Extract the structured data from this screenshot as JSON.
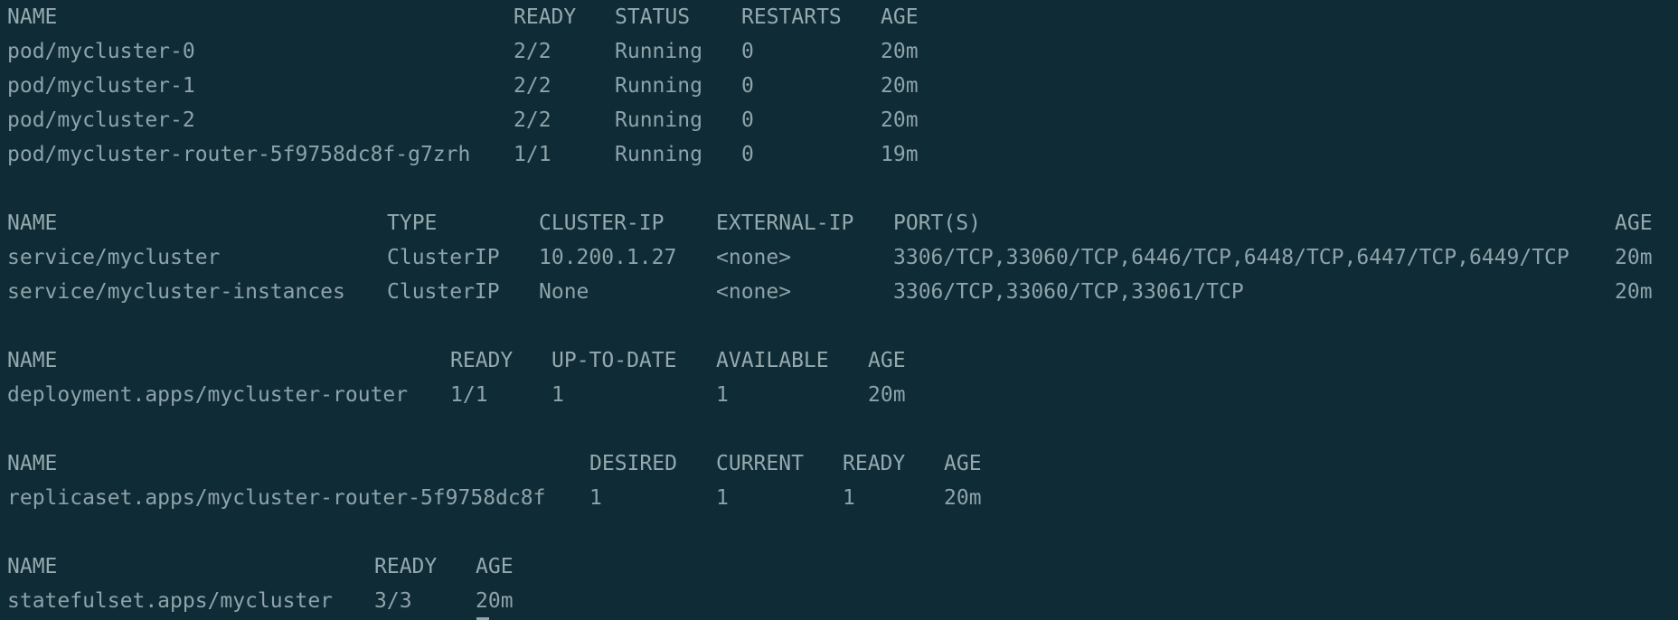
{
  "pods": {
    "headers": [
      "NAME",
      "READY",
      "STATUS",
      "RESTARTS",
      "AGE"
    ],
    "rows": [
      [
        "pod/mycluster-0",
        "2/2",
        "Running",
        "0",
        "20m"
      ],
      [
        "pod/mycluster-1",
        "2/2",
        "Running",
        "0",
        "20m"
      ],
      [
        "pod/mycluster-2",
        "2/2",
        "Running",
        "0",
        "20m"
      ],
      [
        "pod/mycluster-router-5f9758dc8f-g7zrh",
        "1/1",
        "Running",
        "0",
        "19m"
      ]
    ]
  },
  "services": {
    "headers": [
      "NAME",
      "TYPE",
      "CLUSTER-IP",
      "EXTERNAL-IP",
      "PORT(S)",
      "AGE"
    ],
    "rows": [
      [
        "service/mycluster",
        "ClusterIP",
        "10.200.1.27",
        "<none>",
        "3306/TCP,33060/TCP,6446/TCP,6448/TCP,6447/TCP,6449/TCP",
        "20m"
      ],
      [
        "service/mycluster-instances",
        "ClusterIP",
        "None",
        "<none>",
        "3306/TCP,33060/TCP,33061/TCP",
        "20m"
      ]
    ]
  },
  "deployments": {
    "headers": [
      "NAME",
      "READY",
      "UP-TO-DATE",
      "AVAILABLE",
      "AGE"
    ],
    "rows": [
      [
        "deployment.apps/mycluster-router",
        "1/1",
        "1",
        "1",
        "20m"
      ]
    ]
  },
  "replicasets": {
    "headers": [
      "NAME",
      "DESIRED",
      "CURRENT",
      "READY",
      "AGE"
    ],
    "rows": [
      [
        "replicaset.apps/mycluster-router-5f9758dc8f",
        "1",
        "1",
        "1",
        "20m"
      ]
    ]
  },
  "statefulsets": {
    "headers": [
      "NAME",
      "READY",
      "AGE"
    ],
    "rows": [
      [
        "statefulset.apps/mycluster",
        "3/3",
        "20m"
      ]
    ]
  }
}
